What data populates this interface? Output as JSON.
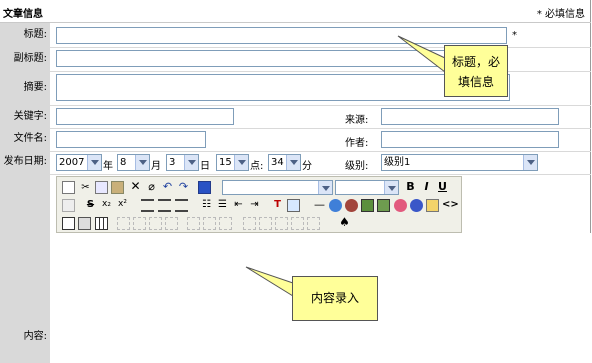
{
  "header": {
    "title": "文章信息",
    "required_note": "* 必填信息"
  },
  "labels": {
    "title": "标题:",
    "subtitle": "副标题:",
    "summary": "摘要:",
    "keywords": "关键字:",
    "source": "来源:",
    "filename": "文件名:",
    "author": "作者:",
    "publish_date": "发布日期:",
    "level": "级别:",
    "content": "内容:"
  },
  "required_star": "*",
  "date": {
    "year": "2007",
    "year_unit": "年",
    "month": "8",
    "month_unit": "月",
    "day": "3",
    "day_unit": "日",
    "hour": "15",
    "hour_unit": "点:",
    "minute": "34",
    "minute_unit": "分"
  },
  "level_value": "级别1",
  "callouts": {
    "title_callout_line1": "标题，必",
    "title_callout_line2": "填信息",
    "content_callout": "内容录入"
  },
  "toolbar": {
    "bold": "B",
    "italic": "I",
    "underline": "U"
  }
}
